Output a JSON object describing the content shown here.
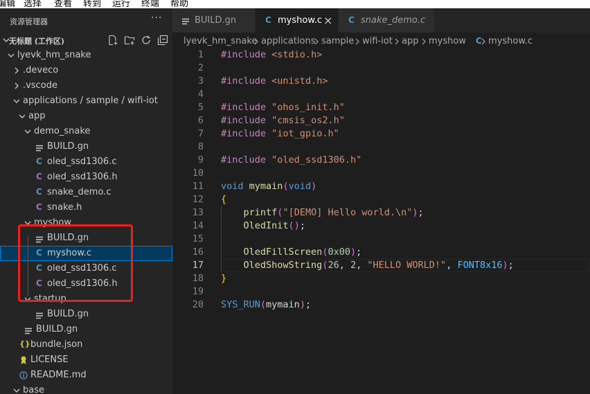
{
  "menubar": {
    "items": [
      "编辑",
      "选择",
      "查看",
      "转到",
      "运行",
      "终端",
      "帮助"
    ]
  },
  "sidebar": {
    "title": "资源管理器",
    "more": "···",
    "workspace_label": "无标题 (工作区)",
    "tree": [
      {
        "label": "lyevk_hm_snake",
        "kind": "folder-open",
        "depth": 0
      },
      {
        "label": ".deveco",
        "kind": "folder-closed",
        "depth": 1
      },
      {
        "label": ".vscode",
        "kind": "folder-closed",
        "depth": 1
      },
      {
        "label": "applications / sample / wifi-iot",
        "kind": "folder-open",
        "depth": 1
      },
      {
        "label": "app",
        "kind": "folder-open",
        "depth": 2
      },
      {
        "label": "demo_snake",
        "kind": "folder-open",
        "depth": 3
      },
      {
        "label": "BUILD.gn",
        "kind": "file-gn",
        "depth": 4
      },
      {
        "label": "oled_ssd1306.c",
        "kind": "file-c",
        "depth": 4
      },
      {
        "label": "oled_ssd1306.h",
        "kind": "file-h",
        "depth": 4
      },
      {
        "label": "snake_demo.c",
        "kind": "file-c",
        "depth": 4
      },
      {
        "label": "snake.h",
        "kind": "file-h",
        "depth": 4
      },
      {
        "label": "myshow",
        "kind": "folder-open",
        "depth": 3
      },
      {
        "label": "BUILD.gn",
        "kind": "file-gn",
        "depth": 4
      },
      {
        "label": "myshow.c",
        "kind": "file-c",
        "depth": 4,
        "selected": true
      },
      {
        "label": "oled_ssd1306.c",
        "kind": "file-c",
        "depth": 4
      },
      {
        "label": "oled_ssd1306.h",
        "kind": "file-h",
        "depth": 4
      },
      {
        "label": "startup",
        "kind": "folder-open",
        "depth": 3
      },
      {
        "label": "BUILD.gn",
        "kind": "file-gn",
        "depth": 4
      },
      {
        "label": "BUILD.gn",
        "kind": "file-gn",
        "depth": 2
      },
      {
        "label": "bundle.json",
        "kind": "file-json",
        "depth": 1
      },
      {
        "label": "LICENSE",
        "kind": "file-license",
        "depth": 1
      },
      {
        "label": "README.md",
        "kind": "file-md",
        "depth": 1
      },
      {
        "label": "base",
        "kind": "folder-open",
        "depth": 1
      }
    ]
  },
  "tabs": [
    {
      "label": "BUILD.gn",
      "kind": "file-gn",
      "active": false,
      "italic": false
    },
    {
      "label": "myshow.c",
      "kind": "file-c",
      "active": true,
      "italic": false,
      "close": "×"
    },
    {
      "label": "snake_demo.c",
      "kind": "file-c",
      "active": false,
      "italic": true
    }
  ],
  "breadcrumb": [
    "lyevk_hm_snake",
    "applications",
    "sample",
    "wifi-iot",
    "app",
    "myshow",
    "myshow.c"
  ],
  "editor": {
    "current_line": 17,
    "lines": [
      "#include <stdio.h>",
      "",
      "#include <unistd.h>",
      "",
      "#include \"ohos_init.h\"",
      "#include \"cmsis_os2.h\"",
      "#include \"iot_gpio.h\"",
      "",
      "#include \"oled_ssd1306.h\"",
      "",
      "void mymain(void)",
      "{",
      "    printf(\"[DEMO] Hello world.\\n\");",
      "    OledInit();",
      "",
      "    OledFillScreen(0x00);",
      "    OledShowString(26, 2, \"HELLO WORLD!\", FONT8x16);",
      "}",
      "",
      "SYS_RUN(mymain);"
    ]
  },
  "colors": {
    "accent": "#007fd4",
    "highlight_box": "#e8231d",
    "c_icon": "#519aba",
    "h_icon": "#a074c4"
  }
}
